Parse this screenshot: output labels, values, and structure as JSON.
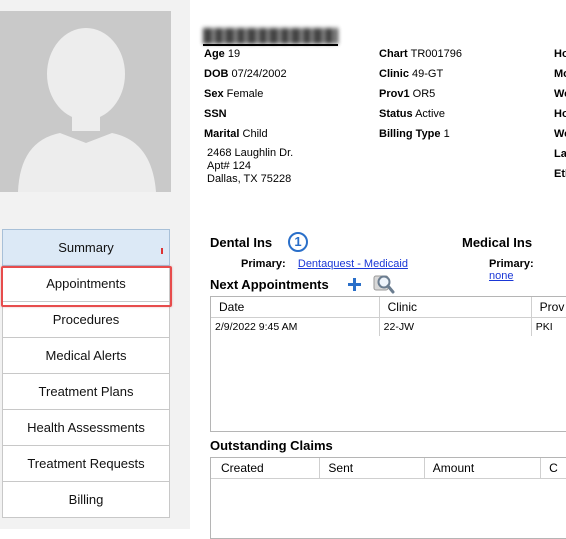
{
  "patient": {
    "age_label": "Age",
    "age": "19",
    "dob_label": "DOB",
    "dob": "07/24/2002",
    "sex_label": "Sex",
    "sex": "Female",
    "ssn_label": "SSN",
    "marital_label": "Marital",
    "marital": "Child",
    "chart_label": "Chart",
    "chart": "TR001796",
    "clinic_label": "Clinic",
    "clinic": "49-GT",
    "prov1_label": "Prov1",
    "prov1": "OR5",
    "status_label": "Status",
    "status": "Active",
    "billing_type_label": "Billing Type",
    "billing_type": "1",
    "address_line1": "2468 Laughlin Dr.",
    "address_line2": "Apt# 124",
    "address_line3": "Dallas,  TX 75228",
    "right_labels_partial": [
      "Ho",
      "Mo",
      "Wo",
      "Ho",
      "Wo",
      "La",
      "Eth"
    ]
  },
  "nav": {
    "items": [
      {
        "label": "Summary"
      },
      {
        "label": "Appointments"
      },
      {
        "label": "Procedures"
      },
      {
        "label": "Medical Alerts"
      },
      {
        "label": "Treatment Plans"
      },
      {
        "label": "Health Assessments"
      },
      {
        "label": "Treatment Requests"
      },
      {
        "label": "Billing"
      }
    ],
    "active_index": 0,
    "highlighted_index": 1
  },
  "dental_ins": {
    "title": "Dental Ins",
    "badge": "1",
    "primary_label": "Primary:",
    "primary_value": "Dentaquest - Medicaid"
  },
  "medical_ins": {
    "title": "Medical Ins",
    "primary_label": "Primary:",
    "primary_value": "none"
  },
  "next_appointments": {
    "title": "Next Appointments",
    "columns": [
      "Date",
      "Clinic",
      "Prov"
    ],
    "rows": [
      [
        "2/9/2022 9:45 AM",
        "22-JW",
        "PKI"
      ]
    ]
  },
  "outstanding_claims": {
    "title": "Outstanding Claims",
    "columns": [
      "Created",
      "Sent",
      "Amount",
      "C"
    ],
    "rows": []
  },
  "colors": {
    "highlight": "#e74c4c",
    "link": "#1a37d6",
    "accent_icon": "#2a6fc9"
  },
  "icons": {
    "add": "plus-icon",
    "search": "search-icon",
    "avatar": "avatar-placeholder-icon"
  }
}
